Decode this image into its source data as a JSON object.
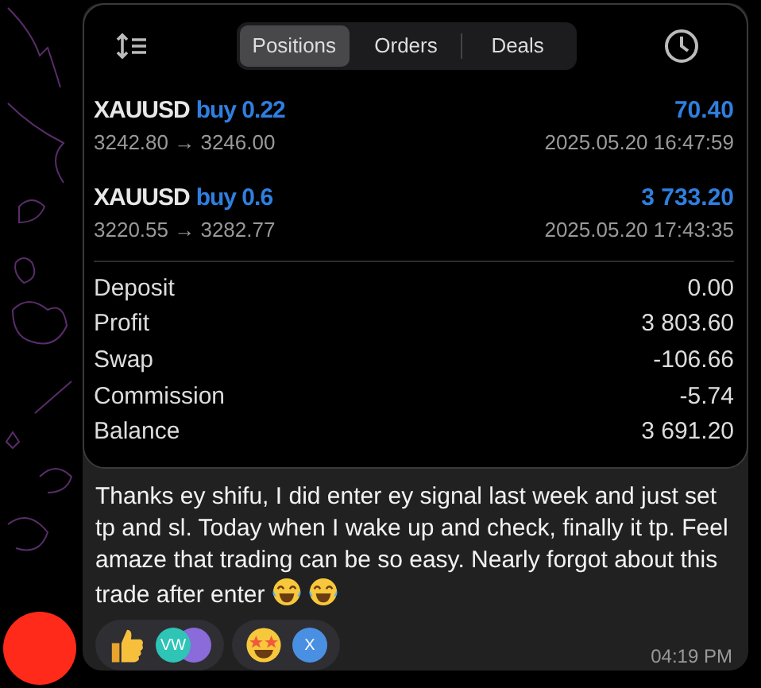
{
  "screenshot": {
    "tabs": [
      {
        "label": "Positions",
        "selected": true
      },
      {
        "label": "Orders",
        "selected": false
      },
      {
        "label": "Deals",
        "selected": false
      }
    ],
    "positions": [
      {
        "symbol": "XAUUSD",
        "side": "buy 0.22",
        "prices": "3242.80 → 3246.00",
        "profit": "70.40",
        "time": "2025.05.20 16:47:59"
      },
      {
        "symbol": "XAUUSD",
        "side": "buy 0.6",
        "prices": "3220.55 → 3282.77",
        "profit": "3 733.20",
        "time": "2025.05.20 17:43:35"
      }
    ],
    "summary": [
      {
        "label": "Deposit",
        "value": "0.00"
      },
      {
        "label": "Profit",
        "value": "3 803.60"
      },
      {
        "label": "Swap",
        "value": "-106.66"
      },
      {
        "label": "Commission",
        "value": "-5.74"
      },
      {
        "label": "Balance",
        "value": "3 691.20"
      }
    ]
  },
  "message": {
    "text": "Thanks ey shifu, I did enter ey signal last week and just set tp and sl. Today when I wake up and check, finally it tp. Feel amaze that trading can be so easy. Nearly forgot about this trade after enter",
    "trailing_emojis": [
      {
        "kind": "laughing"
      },
      {
        "kind": "laughing"
      }
    ],
    "reactions": [
      {
        "kind": "thumbs-up",
        "avatars": [
          {
            "initials": "VW",
            "color": "#2ec4b6"
          },
          {
            "color": "#8b6ad9"
          }
        ]
      },
      {
        "kind": "star-struck",
        "avatars": [
          {
            "initials": "X",
            "color": "#4a90e2"
          }
        ]
      }
    ],
    "time": "04:19 PM"
  }
}
